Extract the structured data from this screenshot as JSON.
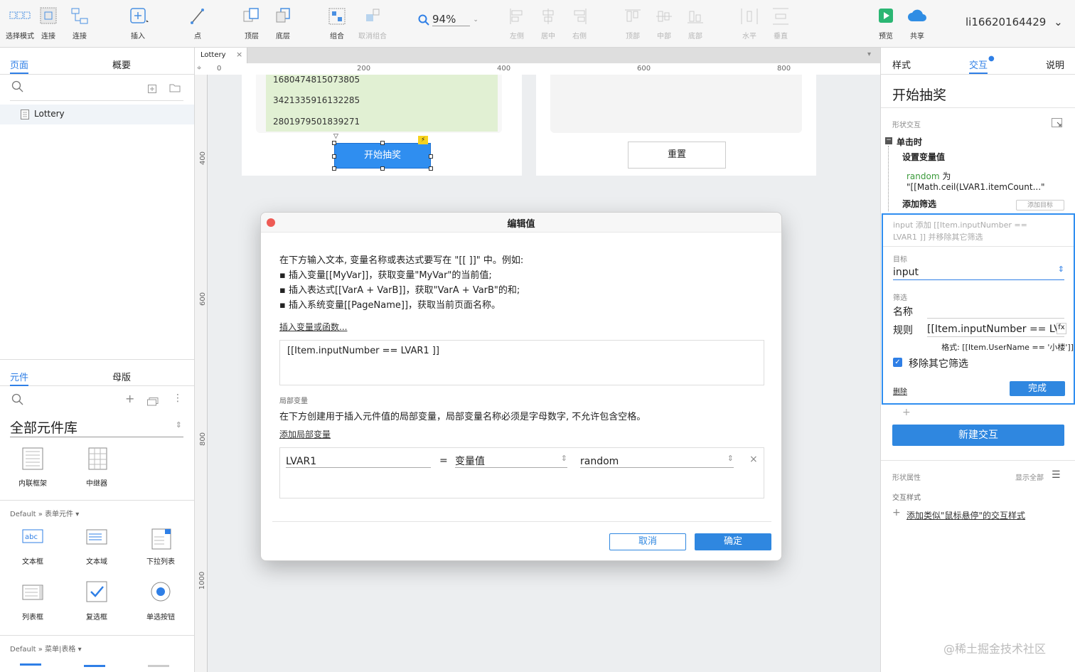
{
  "toolbar": {
    "items": [
      {
        "label": "选择模式"
      },
      {
        "label": "连接"
      },
      {
        "label": "插入"
      },
      {
        "label": "点"
      },
      {
        "label": "顶层"
      },
      {
        "label": "底层"
      },
      {
        "label": "组合"
      },
      {
        "label": "取消组合"
      },
      {
        "label": "左侧"
      },
      {
        "label": "居中"
      },
      {
        "label": "右侧"
      },
      {
        "label": "顶部"
      },
      {
        "label": "中部"
      },
      {
        "label": "底部"
      },
      {
        "label": "水平"
      },
      {
        "label": "垂直"
      },
      {
        "label": "预览"
      },
      {
        "label": "共享"
      }
    ],
    "zoom": "94%",
    "user": "li16620164429"
  },
  "left": {
    "tabs_top": [
      "页面",
      "概要"
    ],
    "page_item": "Lottery",
    "tabs_bottom": [
      "元件",
      "母版"
    ],
    "library_select": "全部元件库",
    "widgets_top": [
      {
        "label": "内联框架"
      },
      {
        "label": "中继器"
      }
    ],
    "section_form": "Default » 表单元件",
    "widgets_form": [
      {
        "label": "文本框"
      },
      {
        "label": "文本域"
      },
      {
        "label": "下拉列表"
      },
      {
        "label": "列表框"
      },
      {
        "label": "复选框"
      },
      {
        "label": "单选按钮"
      }
    ],
    "section_menu": "Default » 菜单|表格"
  },
  "canvas": {
    "tab": "Lottery",
    "ruler_top": [
      "0",
      "200",
      "400",
      "600",
      "800"
    ],
    "ruler_left": [
      "400",
      "600",
      "800",
      "1000"
    ],
    "numbers": [
      "1680474815073805",
      "3421335916132285",
      "2801979501839271"
    ],
    "start_button": "开始抽奖",
    "reset_button": "重置"
  },
  "right": {
    "tabs": [
      "样式",
      "交互",
      "说明"
    ],
    "title": "开始抽奖",
    "shape_interaction": "形状交互",
    "event": "单击时",
    "action": "设置变量值",
    "var_name": "random",
    "var_to": "为",
    "var_value": "\"[[Math.ceil(LVAR1.itemCount...\"",
    "add_filter": "添加筛选",
    "add_target": "添加目标",
    "filter_summary": "input 添加 [[Item.inputNumber == LVAR1 ]] 并移除其它筛选",
    "target_label": "目标",
    "target_value": "input",
    "filter_label": "筛选",
    "name_label": "名称",
    "rule_label": "规则",
    "rule_value": "[[Item.inputNumber == LVA",
    "format_hint": "格式:  [[Item.UserName == '小楼']]",
    "remove_others": "移除其它筛选",
    "delete": "删除",
    "done": "完成",
    "new_interaction": "新建交互",
    "shape_props": "形状属性",
    "show_all": "显示全部",
    "interaction_style": "交互样式",
    "add_style": "添加类似\"鼠标悬停\"的交互样式"
  },
  "dialog": {
    "title": "编辑值",
    "intro": [
      "在下方输入文本, 变量名称或表达式要写在 \"[[ ]]\" 中。例如:",
      "▪ 插入变量[[MyVar]]，获取变量\"MyVar\"的当前值;",
      "▪ 插入表达式[[VarA + VarB]]，获取\"VarA + VarB\"的和;",
      "▪ 插入系统变量[[PageName]]，获取当前页面名称。"
    ],
    "insert_link": "插入变量或函数...",
    "expression": "[[Item.inputNumber == LVAR1 ]]",
    "local_vars_label": "局部变量",
    "local_vars_desc": "在下方创建用于插入元件值的局部变量，局部变量名称必须是字母数字, 不允许包含空格。",
    "add_local_var": "添加局部变量",
    "lvar_name": "LVAR1",
    "lvar_eq": "=",
    "lvar_type": "变量值",
    "lvar_source": "random",
    "cancel": "取消",
    "ok": "确定"
  },
  "watermark": "@稀土掘金技术社区"
}
